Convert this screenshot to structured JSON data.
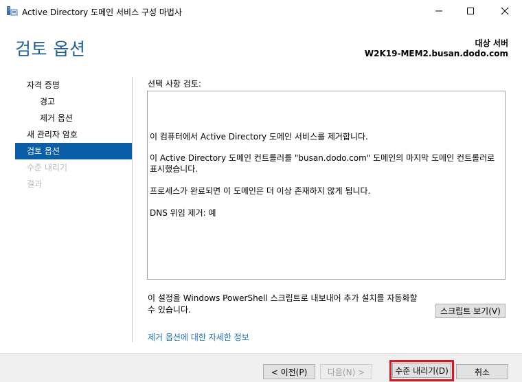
{
  "window": {
    "title": "Active Directory 도메인 서비스 구성 마법사"
  },
  "header": {
    "page_title": "검토 옵션",
    "target_label": "대상 서버",
    "target_server": "W2K19-MEM2.busan.dodo.com"
  },
  "nav": {
    "items": [
      {
        "label": "자격 증명",
        "state": "normal"
      },
      {
        "label": "경고",
        "state": "sub"
      },
      {
        "label": "제거 옵션",
        "state": "sub"
      },
      {
        "label": "새 관리자 암호",
        "state": "normal"
      },
      {
        "label": "검토 옵션",
        "state": "active"
      },
      {
        "label": "수준 내리기",
        "state": "disabled"
      },
      {
        "label": "결과",
        "state": "disabled"
      }
    ]
  },
  "content": {
    "review_label": "선택 사항 검토:",
    "review_lines": [
      "이 컴퓨터에서 Active Directory 도메인 서비스를 제거합니다.",
      "이 Active Directory 도메인 컨트롤러를 \"busan.dodo.com\" 도메인의 마지막 도메인 컨트롤러로",
      "표시했습니다.",
      "프로세스가 완료되면 이 도메인은 더 이상 존재하지 않게 됩니다.",
      "DNS 위임 제거: 예"
    ],
    "ps_note_line1": "이 설정을 Windows PowerShell 스크립트로 내보내어 추가 설치를 자동화할",
    "ps_note_line2": "수 있습니다.",
    "script_button": "스크립트 보기(V)",
    "more_link": "제거 옵션에 대한 자세한 정보"
  },
  "footer": {
    "prev": "< 이전(P)",
    "next": "다음(N) >",
    "demote": "수준 내리기(D)",
    "cancel": "취소"
  },
  "colors": {
    "accent": "#0a5ea8",
    "title_blue": "#1f5f9a",
    "link": "#1e73be",
    "highlight_border": "#e0141e"
  }
}
